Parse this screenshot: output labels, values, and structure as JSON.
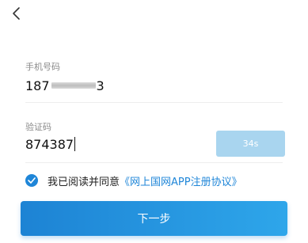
{
  "nav": {
    "back_icon": "chevron-left-icon"
  },
  "phone": {
    "label": "手机号码",
    "value_prefix": "187",
    "value_suffix": "3"
  },
  "code": {
    "label": "验证码",
    "value": "874387",
    "countdown_label": "34s"
  },
  "agreement": {
    "checked": true,
    "text": "我已阅读并同意",
    "link_text": "《网上国网APP注册协议》"
  },
  "next_button": {
    "label": "下一步"
  },
  "colors": {
    "accent": "#1f86d8",
    "disabled_button": "#a9d5ef",
    "label_gray": "#8a8a8a"
  }
}
